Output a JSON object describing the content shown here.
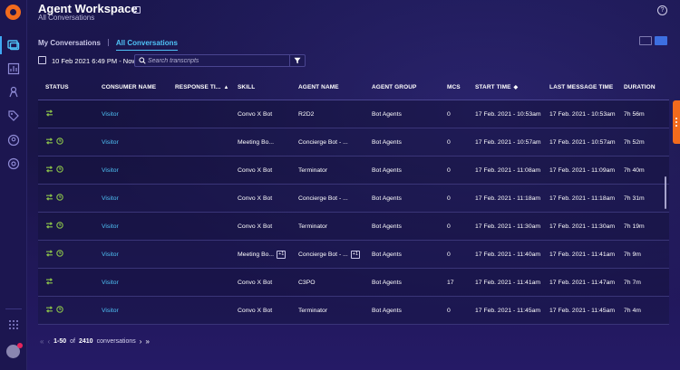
{
  "app": {
    "title": "Agent Workspace",
    "subtitle": "All Conversations",
    "help_icon": "question-icon"
  },
  "rail": {
    "icons": [
      "app-logo-icon",
      "conversations-icon",
      "analytics-icon",
      "manager-icon",
      "tag-icon",
      "user-icon",
      "settings-icon",
      "apps-grid-icon",
      "avatar"
    ],
    "accent_color": "#f26b1d"
  },
  "tabs": [
    {
      "label": "My Conversations",
      "active": false
    },
    {
      "label": "All Conversations",
      "active": true
    }
  ],
  "filters": {
    "date_range": "10 Feb 2021 6:49 PM - Now",
    "search_placeholder": "Search transcripts"
  },
  "table": {
    "columns": {
      "status": "STATUS",
      "consumer": "CONSUMER NAME",
      "response": "RESPONSE TI...",
      "skill": "SKILL",
      "agent": "AGENT NAME",
      "group": "AGENT GROUP",
      "mcs": "MCS",
      "start": "START TIME",
      "last": "LAST MESSAGE TIME",
      "duration": "DURATION"
    },
    "rows": [
      {
        "consumer": "Visitor",
        "skill": "Convo X Bot",
        "skill_more": "",
        "agent": "R2D2",
        "agent_more": "",
        "group": "Bot Agents",
        "mcs": "0",
        "start": "17 Feb. 2021 - 10:53am",
        "last": "17 Feb. 2021 - 10:53am",
        "duration": "7h 56m",
        "timer": false
      },
      {
        "consumer": "Visitor",
        "skill": "Meeting Bo...",
        "skill_more": "",
        "agent": "Concierge Bot - ...",
        "agent_more": "",
        "group": "Bot Agents",
        "mcs": "0",
        "start": "17 Feb. 2021 - 10:57am",
        "last": "17 Feb. 2021 - 10:57am",
        "duration": "7h 52m",
        "timer": true
      },
      {
        "consumer": "Visitor",
        "skill": "Convo X Bot",
        "skill_more": "",
        "agent": "Terminator",
        "agent_more": "",
        "group": "Bot Agents",
        "mcs": "0",
        "start": "17 Feb. 2021 - 11:08am",
        "last": "17 Feb. 2021 - 11:09am",
        "duration": "7h 40m",
        "timer": true
      },
      {
        "consumer": "Visitor",
        "skill": "Convo X Bot",
        "skill_more": "",
        "agent": "Concierge Bot - ...",
        "agent_more": "",
        "group": "Bot Agents",
        "mcs": "0",
        "start": "17 Feb. 2021 - 11:18am",
        "last": "17 Feb. 2021 - 11:18am",
        "duration": "7h 31m",
        "timer": true
      },
      {
        "consumer": "Visitor",
        "skill": "Convo X Bot",
        "skill_more": "",
        "agent": "Terminator",
        "agent_more": "",
        "group": "Bot Agents",
        "mcs": "0",
        "start": "17 Feb. 2021 - 11:30am",
        "last": "17 Feb. 2021 - 11:30am",
        "duration": "7h 19m",
        "timer": true
      },
      {
        "consumer": "Visitor",
        "skill": "Meeting Bo...",
        "skill_more": "+1",
        "agent": "Concierge Bot - ...",
        "agent_more": "+1",
        "group": "Bot Agents",
        "mcs": "0",
        "start": "17 Feb. 2021 - 11:40am",
        "last": "17 Feb. 2021 - 11:41am",
        "duration": "7h 9m",
        "timer": true
      },
      {
        "consumer": "Visitor",
        "skill": "Convo X Bot",
        "skill_more": "",
        "agent": "C3PO",
        "agent_more": "",
        "group": "Bot Agents",
        "mcs": "17",
        "start": "17 Feb. 2021 - 11:41am",
        "last": "17 Feb. 2021 - 11:47am",
        "duration": "7h 7m",
        "timer": false
      },
      {
        "consumer": "Visitor",
        "skill": "Convo X Bot",
        "skill_more": "",
        "agent": "Terminator",
        "agent_more": "",
        "group": "Bot Agents",
        "mcs": "0",
        "start": "17 Feb. 2021 - 11:45am",
        "last": "17 Feb. 2021 - 11:45am",
        "duration": "7h 4m",
        "timer": true
      }
    ]
  },
  "pager": {
    "range": "1-50",
    "of": "of",
    "total": "2410",
    "unit": "conversations"
  },
  "colors": {
    "status_green": "#8bc34a",
    "link_blue": "#4fc3f7"
  }
}
